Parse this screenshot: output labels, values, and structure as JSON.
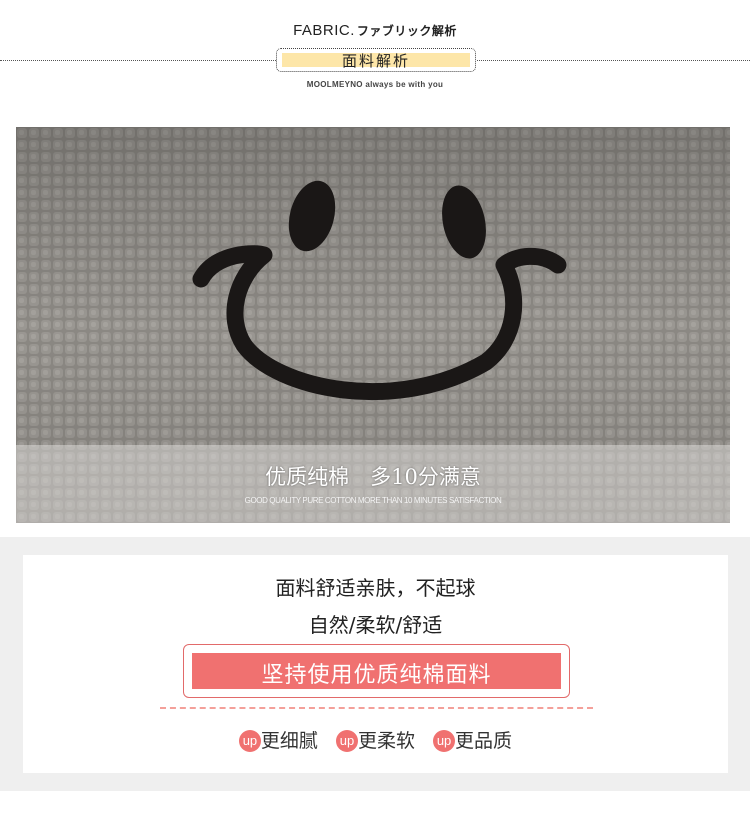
{
  "header": {
    "title_en": "FABRIC.",
    "title_jp": "ファブリック解析",
    "badge": "面料解析",
    "tagline": "MOOLMEYNO always  be with you"
  },
  "photo": {
    "caption": "优质纯棉　多10分满意",
    "caption_en": "GOOD QUALITY PURE COTTON MORE THAN 10 MINUTES SATISFACTION"
  },
  "card": {
    "line1": "面料舒适亲肤，不起球",
    "line2": "自然/柔软/舒适",
    "banner": "坚持使用优质纯棉面料",
    "features": [
      {
        "badge": "up",
        "label": "更细腻"
      },
      {
        "badge": "up",
        "label": "更柔软"
      },
      {
        "badge": "up",
        "label": "更品质"
      }
    ]
  },
  "colors": {
    "accent": "#f07170",
    "badge_fill": "#fde6a8",
    "fabric": "#8a8782",
    "embroidery": "#1a1716"
  }
}
